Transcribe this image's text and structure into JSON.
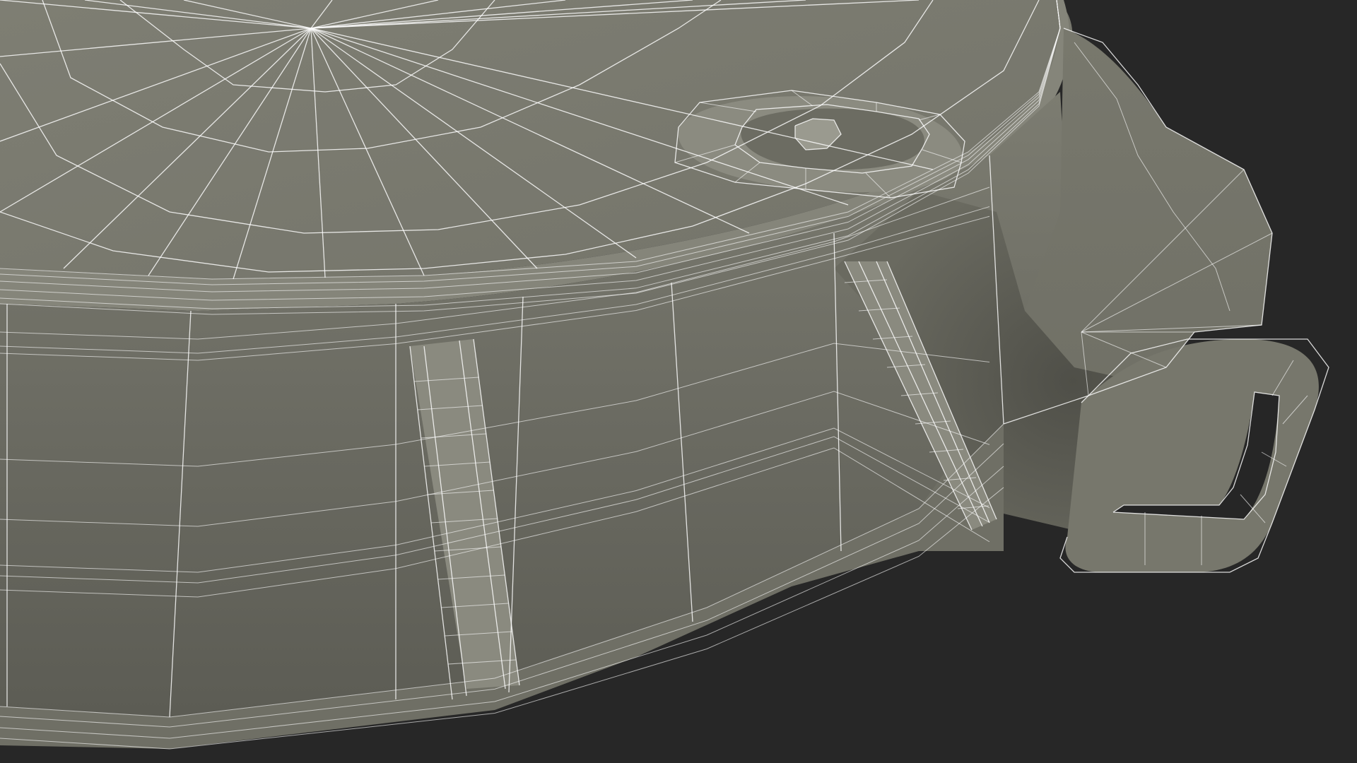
{
  "scene": {
    "background_color": "#272727",
    "mesh_color": "#7a7a6f",
    "mesh_shadow_color": "#55554d",
    "wire_color": "#ffffff",
    "display_mode": "wireframe-on-shaded"
  }
}
